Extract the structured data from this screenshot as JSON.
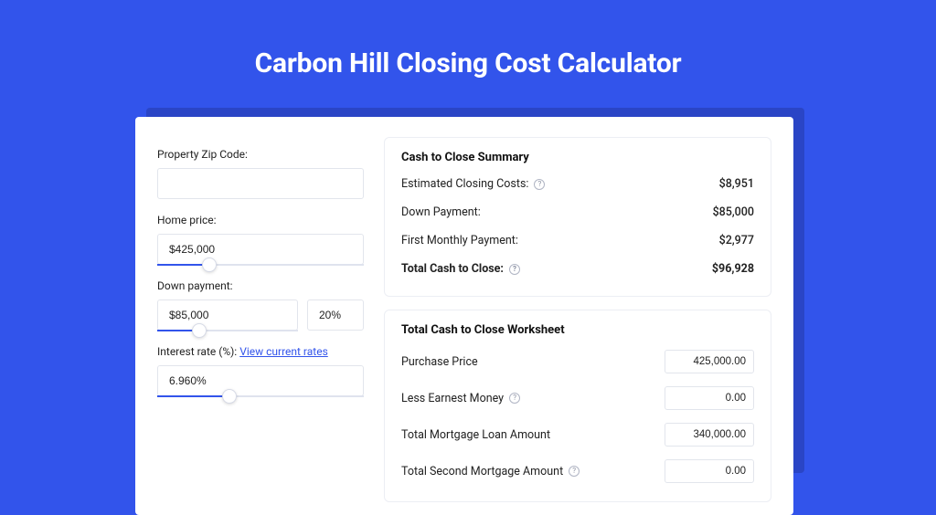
{
  "title": "Carbon Hill Closing Cost Calculator",
  "left": {
    "zip_label": "Property Zip Code:",
    "zip_value": "",
    "home_price_label": "Home price:",
    "home_price_value": "$425,000",
    "home_price_slider_pct": 25,
    "down_payment_label": "Down payment:",
    "down_payment_value": "$85,000",
    "down_payment_pct": "20%",
    "down_payment_slider_pct": 30,
    "interest_label_prefix": "Interest rate (%): ",
    "interest_link": "View current rates",
    "interest_value": "6.960%",
    "interest_slider_pct": 35
  },
  "summary": {
    "title": "Cash to Close Summary",
    "rows": [
      {
        "label": "Estimated Closing Costs:",
        "help": true,
        "value": "$8,951"
      },
      {
        "label": "Down Payment:",
        "help": false,
        "value": "$85,000"
      },
      {
        "label": "First Monthly Payment:",
        "help": false,
        "value": "$2,977"
      }
    ],
    "total": {
      "label": "Total Cash to Close:",
      "help": true,
      "value": "$96,928"
    }
  },
  "worksheet": {
    "title": "Total Cash to Close Worksheet",
    "rows": [
      {
        "label": "Purchase Price",
        "help": false,
        "value": "425,000.00"
      },
      {
        "label": "Less Earnest Money",
        "help": true,
        "value": "0.00"
      },
      {
        "label": "Total Mortgage Loan Amount",
        "help": false,
        "value": "340,000.00"
      },
      {
        "label": "Total Second Mortgage Amount",
        "help": true,
        "value": "0.00"
      }
    ]
  }
}
